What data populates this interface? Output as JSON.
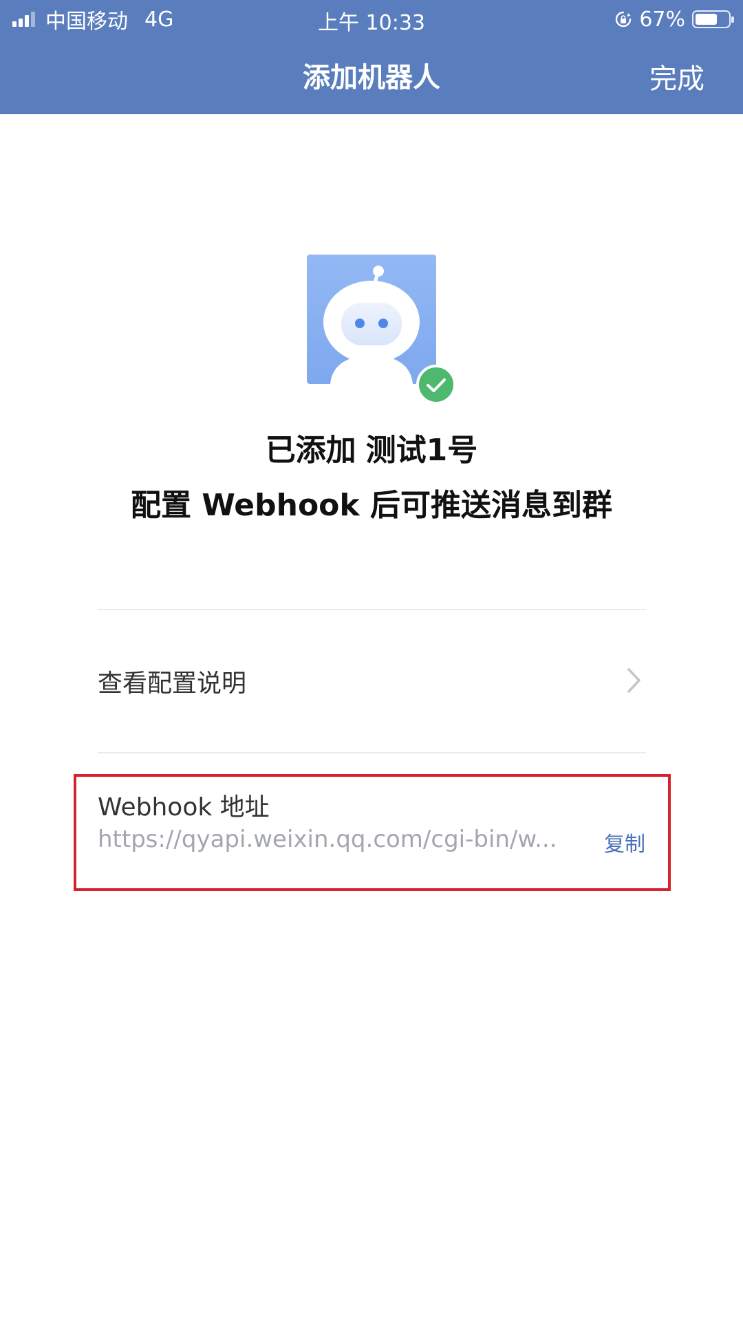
{
  "status_bar": {
    "carrier": "中国移动",
    "network": "4G",
    "time": "上午 10:33",
    "battery": "67%",
    "battery_level": 0.67
  },
  "nav": {
    "title": "添加机器人",
    "done_label": "完成"
  },
  "robot": {
    "added_prefix": "已添加",
    "name": "测试1号",
    "subtitle": "配置 Webhook 后可推送消息到群"
  },
  "config_row": {
    "label": "查看配置说明"
  },
  "webhook": {
    "title": "Webhook 地址",
    "url": "https://qyapi.weixin.qq.com/cgi-bin/w...",
    "copy_label": "复制"
  },
  "colors": {
    "nav_background": "#5a7dbd",
    "highlight_border": "#d6232b",
    "link": "#4a6fb5",
    "success": "#4cb96f",
    "avatar_background": "#8fb5f2"
  },
  "icons": {
    "signal": "signal-icon",
    "rotation_lock": "rotation-lock-icon",
    "battery": "battery-icon",
    "robot": "robot-avatar-icon",
    "check": "check-badge-icon",
    "chevron": "chevron-right-icon"
  }
}
